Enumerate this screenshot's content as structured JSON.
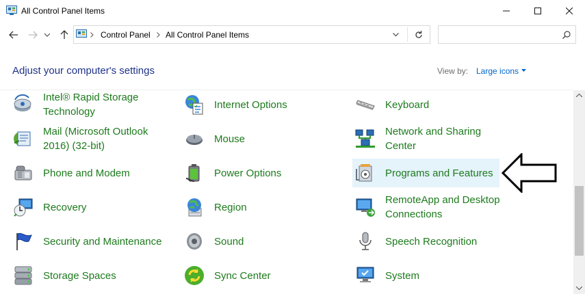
{
  "window": {
    "title": "All Control Panel Items",
    "controls": {
      "minimize": "minimize",
      "maximize": "maximize",
      "close": "close"
    }
  },
  "address": {
    "breadcrumbs": [
      "Control Panel",
      "All Control Panel Items"
    ],
    "search_placeholder": ""
  },
  "header": {
    "heading": "Adjust your computer's settings",
    "view_by_label": "View by:",
    "view_by_value": "Large icons"
  },
  "items": [
    {
      "label": "Intel® Rapid Storage Technology",
      "lines": [
        "Intel® Rapid Storage",
        "Technology"
      ],
      "icon": "intel-storage-icon"
    },
    {
      "label": "Internet Options",
      "lines": [
        "Internet Options"
      ],
      "icon": "internet-options-icon"
    },
    {
      "label": "Keyboard",
      "lines": [
        "Keyboard"
      ],
      "icon": "keyboard-icon"
    },
    {
      "label": "Mail (Microsoft Outlook 2016) (32-bit)",
      "lines": [
        "Mail (Microsoft Outlook",
        "2016) (32-bit)"
      ],
      "icon": "mail-icon"
    },
    {
      "label": "Mouse",
      "lines": [
        "Mouse"
      ],
      "icon": "mouse-icon"
    },
    {
      "label": "Network and Sharing Center",
      "lines": [
        "Network and Sharing",
        "Center"
      ],
      "icon": "network-icon"
    },
    {
      "label": "Phone and Modem",
      "lines": [
        "Phone and Modem"
      ],
      "icon": "phone-icon"
    },
    {
      "label": "Power Options",
      "lines": [
        "Power Options"
      ],
      "icon": "power-icon"
    },
    {
      "label": "Programs and Features",
      "lines": [
        "Programs and Features"
      ],
      "icon": "programs-icon",
      "highlighted": true
    },
    {
      "label": "Recovery",
      "lines": [
        "Recovery"
      ],
      "icon": "recovery-icon"
    },
    {
      "label": "Region",
      "lines": [
        "Region"
      ],
      "icon": "region-icon"
    },
    {
      "label": "RemoteApp and Desktop Connections",
      "lines": [
        "RemoteApp and Desktop",
        "Connections"
      ],
      "icon": "remoteapp-icon"
    },
    {
      "label": "Security and Maintenance",
      "lines": [
        "Security and Maintenance"
      ],
      "icon": "security-flag-icon"
    },
    {
      "label": "Sound",
      "lines": [
        "Sound"
      ],
      "icon": "speaker-icon"
    },
    {
      "label": "Speech Recognition",
      "lines": [
        "Speech Recognition"
      ],
      "icon": "microphone-icon"
    },
    {
      "label": "Storage Spaces",
      "lines": [
        "Storage Spaces"
      ],
      "icon": "storage-icon"
    },
    {
      "label": "Sync Center",
      "lines": [
        "Sync Center"
      ],
      "icon": "sync-icon"
    },
    {
      "label": "System",
      "lines": [
        "System"
      ],
      "icon": "system-icon"
    }
  ],
  "colors": {
    "heading": "#1e3287",
    "item_text": "#1d7a1d",
    "link": "#0066cc",
    "highlight": "#e5f3fb"
  }
}
